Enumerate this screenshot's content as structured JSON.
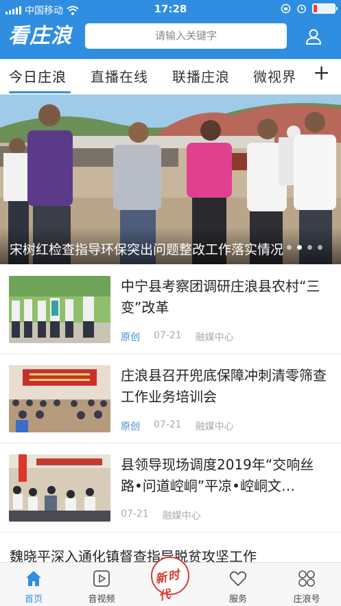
{
  "status_bar": {
    "carrier": "中国移动",
    "time": "17:28"
  },
  "header": {
    "logo_text": "看庄浪",
    "search_placeholder": "请输入关键字"
  },
  "tabs": [
    {
      "label": "今日庄浪",
      "active": true
    },
    {
      "label": "直播在线",
      "active": false
    },
    {
      "label": "联播庄浪",
      "active": false
    },
    {
      "label": "微视界",
      "active": false
    }
  ],
  "tab_more": "+",
  "hero": {
    "title": "宋树红检查指导环保突出问题整改工作落实情况"
  },
  "news": [
    {
      "title": "中宁县考察团调研庄浪县农村“三变”改革",
      "tag": "原创",
      "date": "07-21",
      "source": "融媒中心"
    },
    {
      "title": "庄浪县召开兜底保障冲刺清零筛查工作业务培训会",
      "tag": "原创",
      "date": "07-21",
      "source": "融媒中心"
    },
    {
      "title": "县领导现场调度2019年“交响丝路•问道崆峒”平凉•崆峒文…",
      "tag": "",
      "date": "07-21",
      "source": "融媒中心"
    }
  ],
  "partial_title": "魏晓平深入通化镇督查指导脱贫攻坚工作",
  "bottom_nav": [
    {
      "label": "首页",
      "icon": "home-icon",
      "active": true
    },
    {
      "label": "音视频",
      "icon": "play-icon",
      "active": false
    },
    {
      "label": "新时代",
      "icon": "center-logo",
      "active": false
    },
    {
      "label": "服务",
      "icon": "heart-icon",
      "active": false
    },
    {
      "label": "庄浪号",
      "icon": "grid-icon",
      "active": false
    }
  ],
  "colors": {
    "brand": "#2f8ee0",
    "tag": "#3a8fd8",
    "center_logo": "#d9382c"
  }
}
